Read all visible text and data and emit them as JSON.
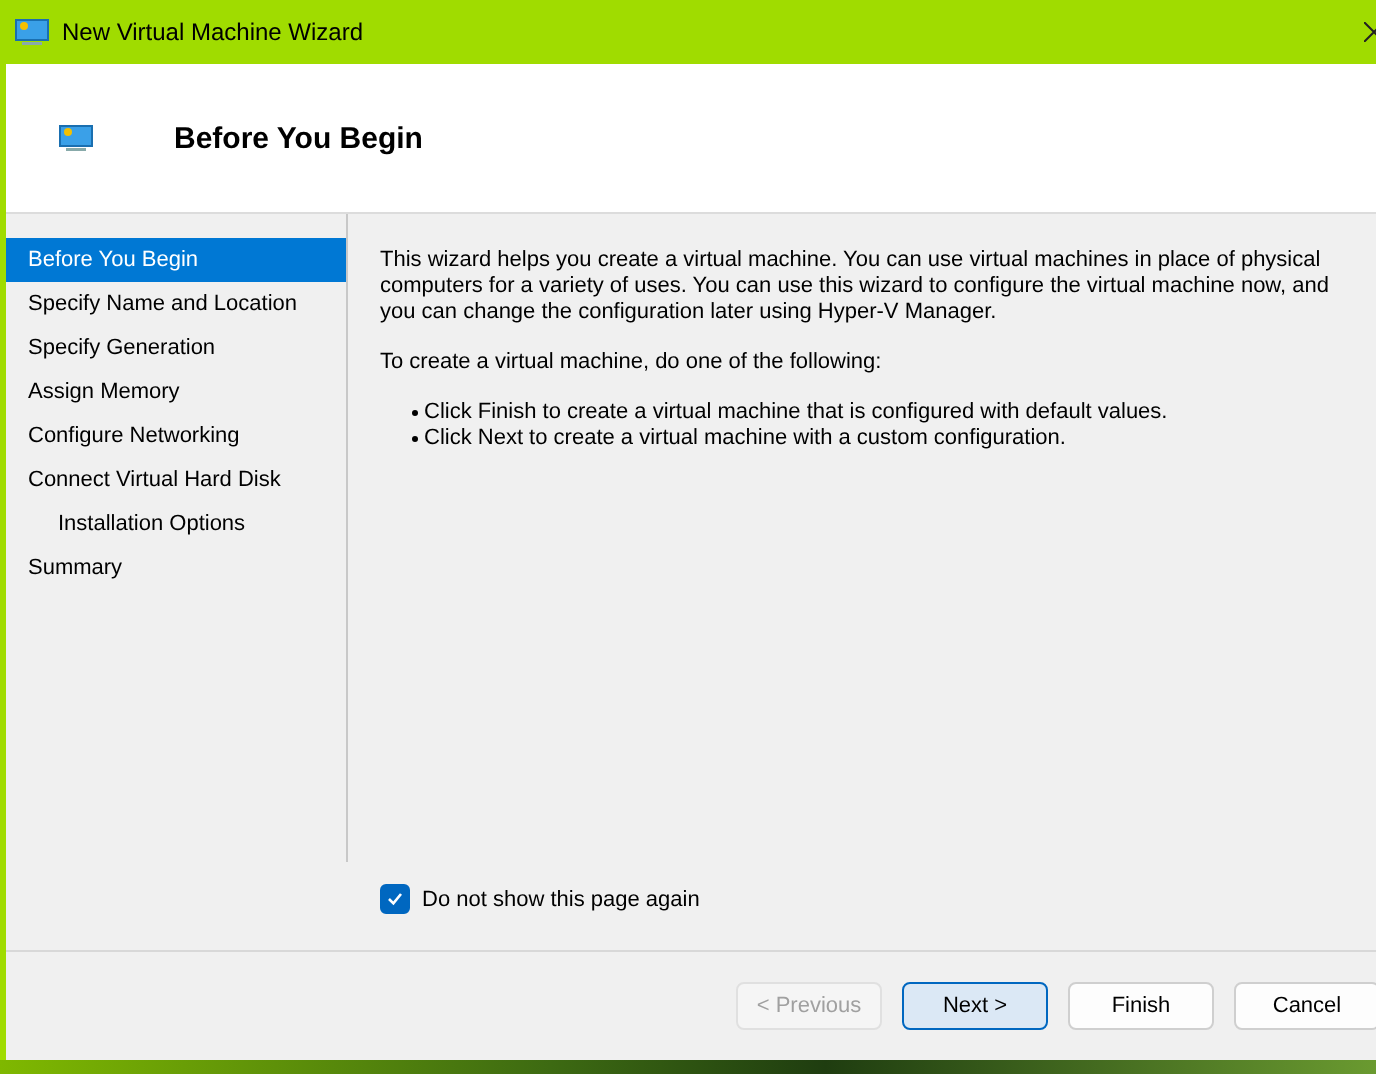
{
  "window": {
    "title": "New Virtual Machine Wizard"
  },
  "header": {
    "title": "Before You Begin"
  },
  "steps": [
    {
      "label": "Before You Begin",
      "selected": true
    },
    {
      "label": "Specify Name and Location",
      "selected": false
    },
    {
      "label": "Specify Generation",
      "selected": false
    },
    {
      "label": "Assign Memory",
      "selected": false
    },
    {
      "label": "Configure Networking",
      "selected": false
    },
    {
      "label": "Connect Virtual Hard Disk",
      "selected": false,
      "children": [
        {
          "label": "Installation Options",
          "selected": false
        }
      ]
    },
    {
      "label": "Summary",
      "selected": false
    }
  ],
  "content": {
    "paragraphs": [
      "This wizard helps you create a virtual machine. You can use virtual machines in place of physical computers for a variety of uses. You can use this wizard to configure the virtual machine now, and you can change the configuration later using Hyper-V Manager.",
      "To create a virtual machine, do one of the following:"
    ],
    "bullets": [
      "Click Finish to create a virtual machine that is configured with default values.",
      "Click Next to create a virtual machine with a custom configuration."
    ]
  },
  "dont_show_again": {
    "label": "Do not show this page again",
    "checked": true
  },
  "buttons": [
    {
      "label": "< Previous",
      "disabled": true,
      "default": false
    },
    {
      "label": "Next >",
      "disabled": false,
      "default": true
    },
    {
      "label": "Finish",
      "disabled": false,
      "default": false
    },
    {
      "label": "Cancel",
      "disabled": false,
      "default": false
    }
  ]
}
